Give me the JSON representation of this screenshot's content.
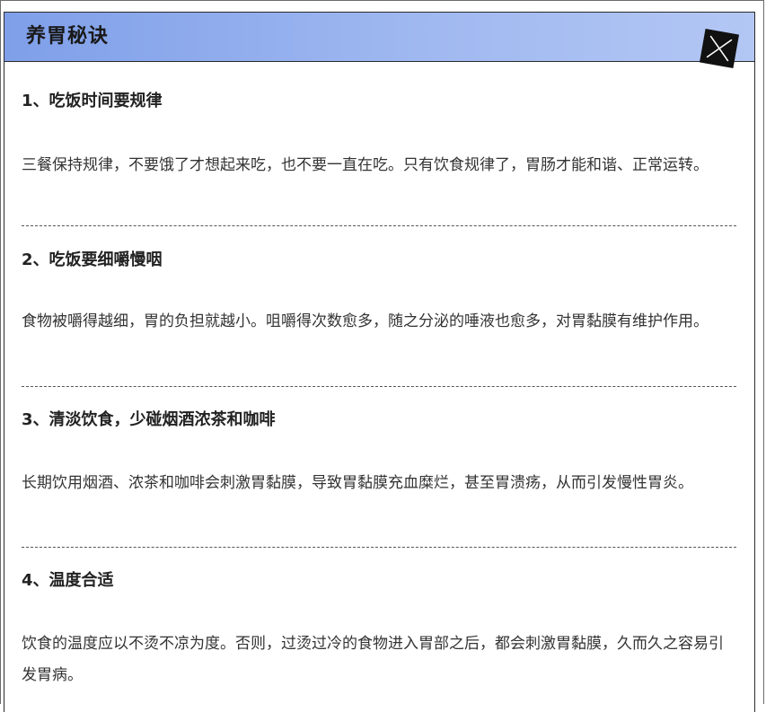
{
  "header": {
    "title": "养胃秘诀",
    "close_icon": "close-x-icon"
  },
  "sections": [
    {
      "heading": "1、吃饭时间要规律",
      "body": "三餐保持规律，不要饿了才想起来吃，也不要一直在吃。只有饮食规律了，胃肠才能和谐、正常运转。"
    },
    {
      "heading": "2、吃饭要细嚼慢咽",
      "body": "食物被嚼得越细，胃的负担就越小。咀嚼得次数愈多，随之分泌的唾液也愈多，对胃黏膜有维护作用。"
    },
    {
      "heading": "3、清淡饮食，少碰烟酒浓茶和咖啡",
      "body": "长期饮用烟酒、浓茶和咖啡会刺激胃黏膜，导致胃黏膜充血糜烂，甚至胃溃疡，从而引发慢性胃炎。"
    },
    {
      "heading": "4、温度合适",
      "body": "饮食的温度应以不烫不凉为度。否则，过烫过冷的食物进入胃部之后，都会刺激胃黏膜，久而久之容易引发胃病。"
    }
  ],
  "colors": {
    "header_gradient_start": "#7f9fe9",
    "header_gradient_end": "#b3c7f4",
    "text": "#222222",
    "divider": "#555555"
  }
}
